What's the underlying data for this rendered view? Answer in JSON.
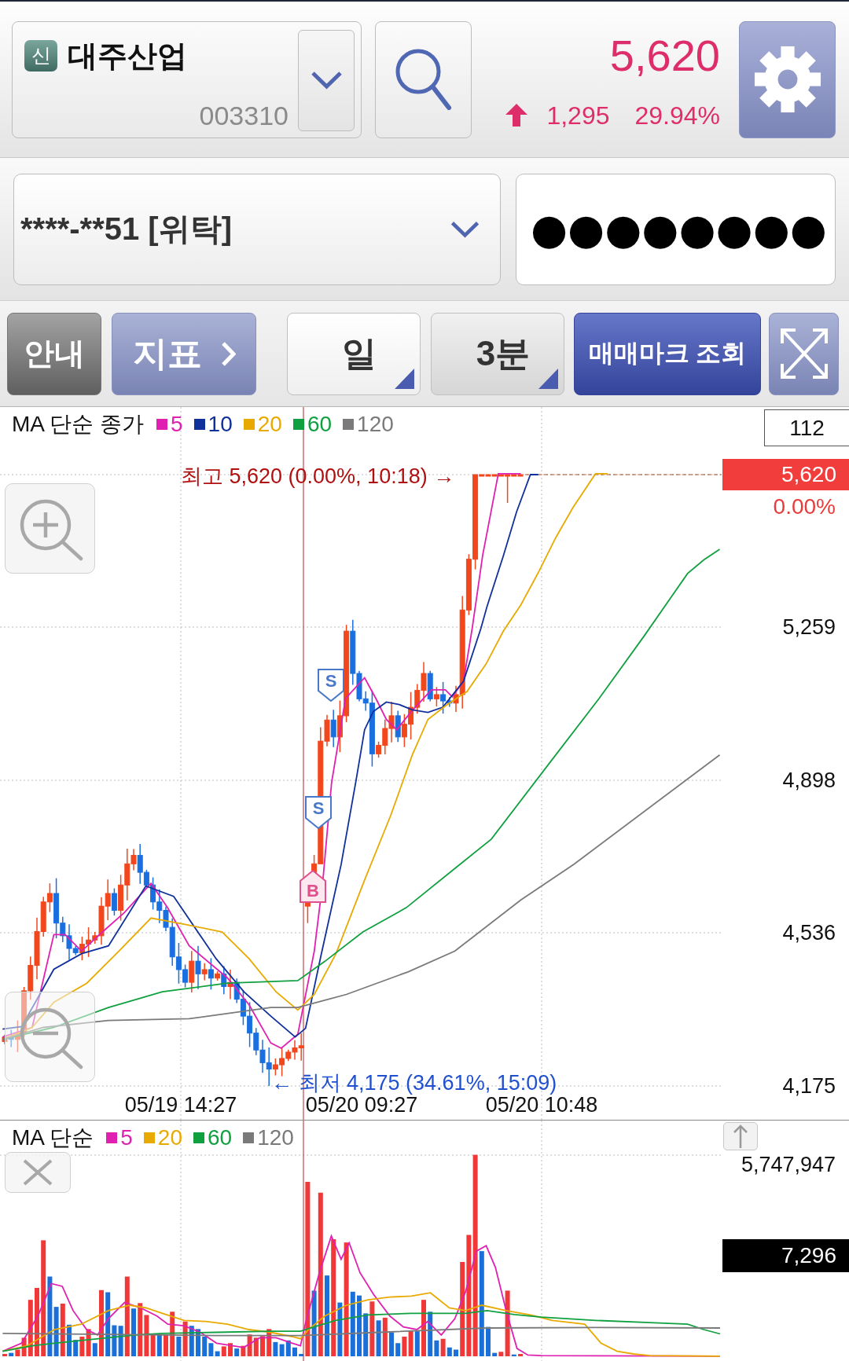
{
  "stock": {
    "tag": "신",
    "name": "대주산업",
    "code": "003310"
  },
  "quote": {
    "price": "5,620",
    "rising": true,
    "change": "1,295",
    "change_rate": "29.94%"
  },
  "account": {
    "value": "****-**51 [위탁]"
  },
  "password": {
    "value": "●●●●●●●●"
  },
  "toolbar": [
    {
      "kind": "guide",
      "label": "안내"
    },
    {
      "kind": "indicator",
      "label": "지표"
    },
    {
      "kind": "date",
      "label": "일"
    },
    {
      "kind": "interval",
      "label": "3분"
    },
    {
      "kind": "marks",
      "label": "매매마크 조회"
    },
    {
      "kind": "expand"
    }
  ],
  "price_chart": {
    "legend_title": "MA 단순 종가",
    "legend": [
      {
        "label": "5",
        "color": "#e020b0"
      },
      {
        "label": "10",
        "color": "#10309c"
      },
      {
        "label": "20",
        "color": "#e8aa00"
      },
      {
        "label": "60",
        "color": "#10a040"
      },
      {
        "label": "120",
        "color": "#7a7a7a"
      }
    ],
    "count": "112",
    "current_price": "5,620",
    "current_rate": "0.00%",
    "y_labels": [
      "5,259",
      "4,898",
      "4,536",
      "4,175"
    ],
    "x_labels": [
      "05/19 14:27",
      "05/20 09:27",
      "05/20 10:48"
    ],
    "high_label": "최고 5,620 (0.00%, 10:18) →",
    "low_label": "← 최저 4,175 (34.61%, 15:09)",
    "markers": [
      {
        "kind": "sell",
        "label": "S"
      },
      {
        "kind": "sell",
        "label": "S"
      },
      {
        "kind": "buy",
        "label": "B"
      }
    ]
  },
  "volume_chart": {
    "legend_title": "MA 단순",
    "legend": [
      {
        "label": "5",
        "color": "#e020b0"
      },
      {
        "label": "20",
        "color": "#e8aa00"
      },
      {
        "label": "60",
        "color": "#10a040"
      },
      {
        "label": "120",
        "color": "#7a7a7a"
      }
    ],
    "max_label": "5,747,947",
    "current": "7,296"
  }
}
